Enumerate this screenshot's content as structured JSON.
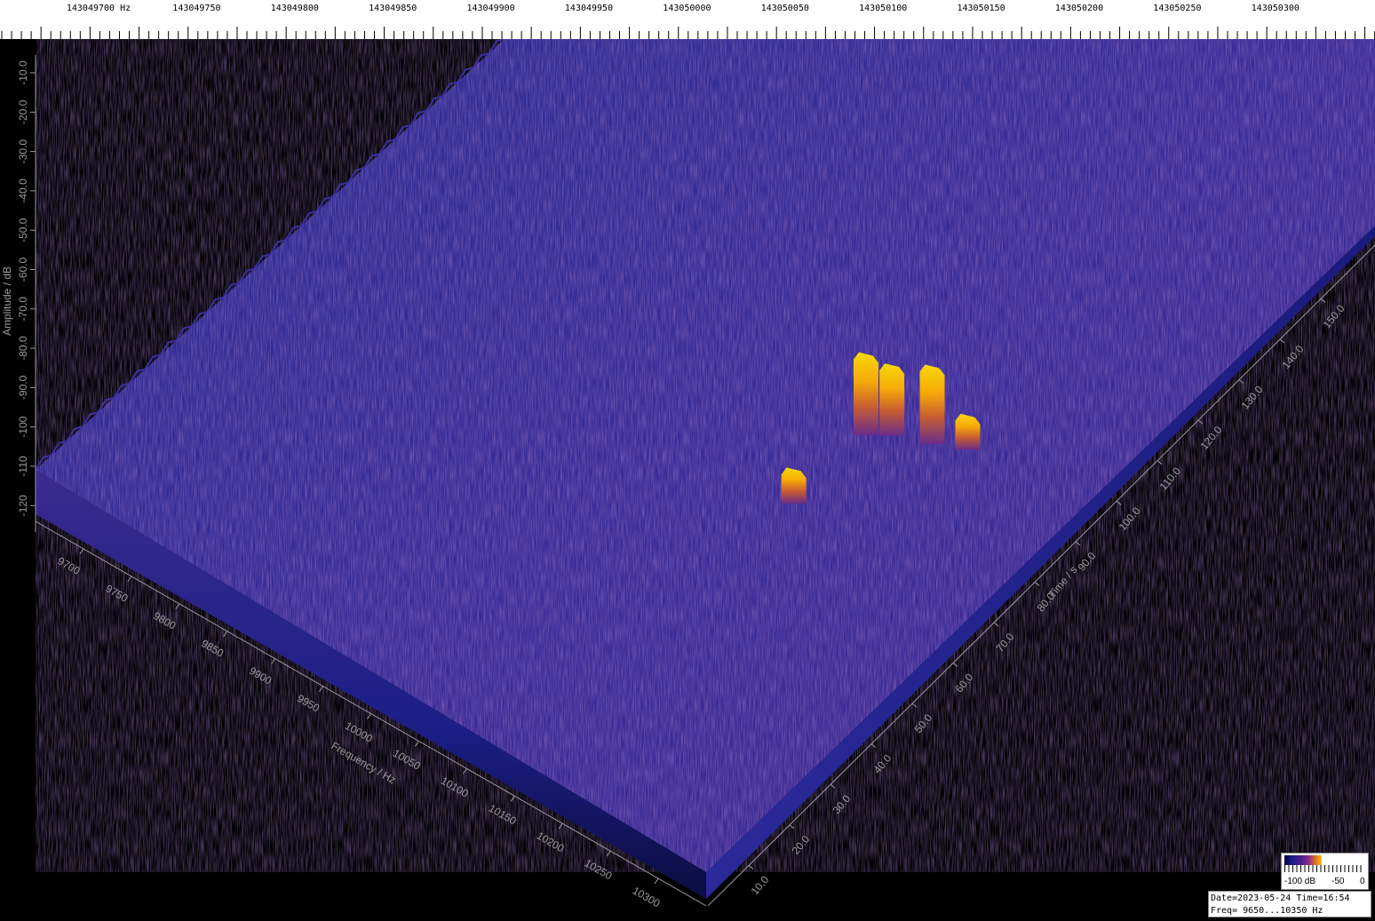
{
  "top_axis": {
    "labels": [
      "143049700 Hz",
      "143049750",
      "143049800",
      "143049850",
      "143049900",
      "143049950",
      "143050000",
      "143050050",
      "143050100",
      "143050150",
      "143050200",
      "143050250",
      "143050300"
    ]
  },
  "chart_data": {
    "type": "3d-waterfall",
    "x_axis": {
      "label": "Frequency / Hz",
      "ticks": [
        "9700",
        "9750",
        "9800",
        "9850",
        "9900",
        "9950",
        "10000",
        "10050",
        "10100",
        "10150",
        "10200",
        "10250",
        "10300"
      ],
      "range": [
        9650,
        10350
      ]
    },
    "y_axis": {
      "label": "Time / s",
      "ticks": [
        "10.0",
        "20.0",
        "30.0",
        "40.0",
        "50.0",
        "60.0",
        "70.0",
        "80.0",
        "90.0",
        "100.0",
        "110.0",
        "120.0",
        "130.0",
        "140.0",
        "150.0"
      ],
      "range": [
        0,
        160
      ]
    },
    "z_axis": {
      "label": "Amplitude / dB",
      "ticks": [
        "-10.0",
        "-20.0",
        "-30.0",
        "-40.0",
        "-50.0",
        "-60.0",
        "-70.0",
        "-80.0",
        "-90.0",
        "-100",
        "-110",
        "-120"
      ],
      "range": [
        -130,
        0
      ]
    },
    "noise_floor_db": -118,
    "signal_peaks": [
      {
        "freq_hz": 10095,
        "time_s": 70,
        "amplitude_db": -95
      },
      {
        "freq_hz": 10110,
        "time_s": 72,
        "amplitude_db": -98
      },
      {
        "freq_hz": 10140,
        "time_s": 74,
        "amplitude_db": -96
      },
      {
        "freq_hz": 10165,
        "time_s": 76,
        "amplitude_db": -108
      },
      {
        "freq_hz": 10110,
        "time_s": 55,
        "amplitude_db": -108
      }
    ],
    "colormap": [
      "#1a1a7a",
      "#4b2592",
      "#7a2a8c",
      "#c0503a",
      "#f59a20",
      "#ffd000"
    ]
  },
  "colorbar": {
    "labels": [
      "-100 dB",
      "-50",
      "0"
    ]
  },
  "info": {
    "line1": "Date=2023-05-24 Time=16:54",
    "line2": "Freq= 9650...10350 Hz"
  }
}
